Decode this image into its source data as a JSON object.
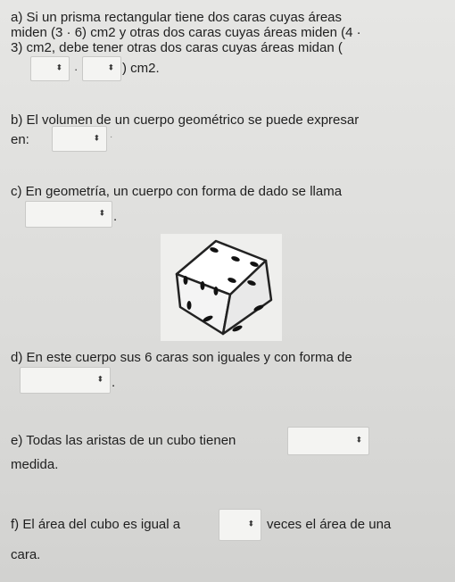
{
  "questions": {
    "a": {
      "line1": "a) Si un prisma rectangular tiene dos caras cuyas áreas",
      "line2": "miden (3 · 6) cm2 y otras dos caras cuyas áreas miden (4 ·",
      "line3": "3) cm2, debe tener otras dos caras cuyas áreas midan (",
      "mult": "·",
      "suffix": ") cm2."
    },
    "b": {
      "line1": "b) El volumen de un cuerpo geométrico se puede expresar",
      "line2_prefix": "en:",
      "suffix": "·"
    },
    "c": {
      "line1": "c) En geometría, un cuerpo con forma de dado se llama",
      "suffix": "."
    },
    "d": {
      "line1": "d) En este cuerpo sus 6 caras son iguales y con forma de",
      "suffix": "."
    },
    "e": {
      "line1_prefix": "e) Todas las aristas de un cubo tienen",
      "line2": "medida."
    },
    "f": {
      "prefix": "f) El área del cubo es igual a",
      "suffix": "veces el área de una",
      "line2": "cara."
    }
  },
  "dropdown_arrow": "⬍",
  "image": {
    "icon": "dice-icon"
  }
}
